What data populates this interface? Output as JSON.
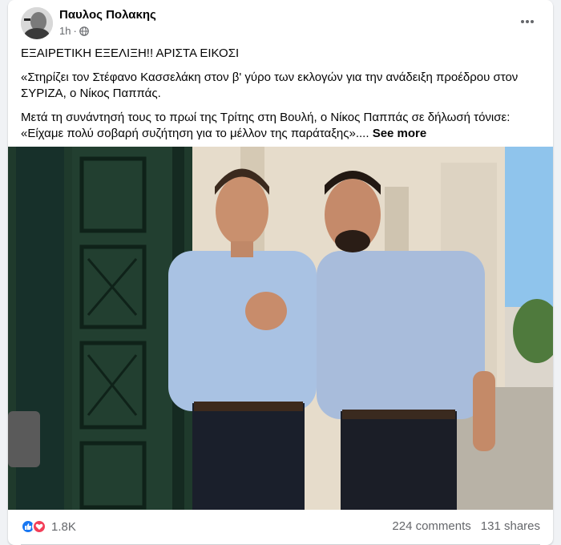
{
  "post": {
    "author": "Παυλος Πολακης",
    "time": "1h",
    "visibility_icon": "globe-icon",
    "more_icon": "more-horizontal-icon",
    "paragraphs": [
      "ΕΞΑΙΡΕΤΙΚΗ ΕΞΕΛΙΞΗ!! ΑΡΙΣΤΑ ΕΙΚΟΣΙ",
      "«Στηρίζει τον Στέφανο Κασσελάκη στον β' γύρο των εκλογών για την ανάδειξη προέδρου στον ΣΥΡΙΖΑ, ο Νίκος Παππάς."
    ],
    "last_paragraph": "Μετά τη συνάντησή τους το πρωί της Τρίτης στη Βουλή, ο Νίκος Παππάς σε δήλωσή τόνισε: «Είχαμε πολύ σοβαρή συζήτηση για το μέλλον της παράταξης»....",
    "see_more": "See more"
  },
  "footer": {
    "reaction_icons": [
      "like-icon",
      "love-icon"
    ],
    "reaction_count": "1.8K",
    "comments": "224 comments",
    "shares": "131 shares"
  },
  "colors": {
    "facebook_blue": "#1877f2",
    "love_red": "#f33e58",
    "secondary_text": "#65676b"
  }
}
